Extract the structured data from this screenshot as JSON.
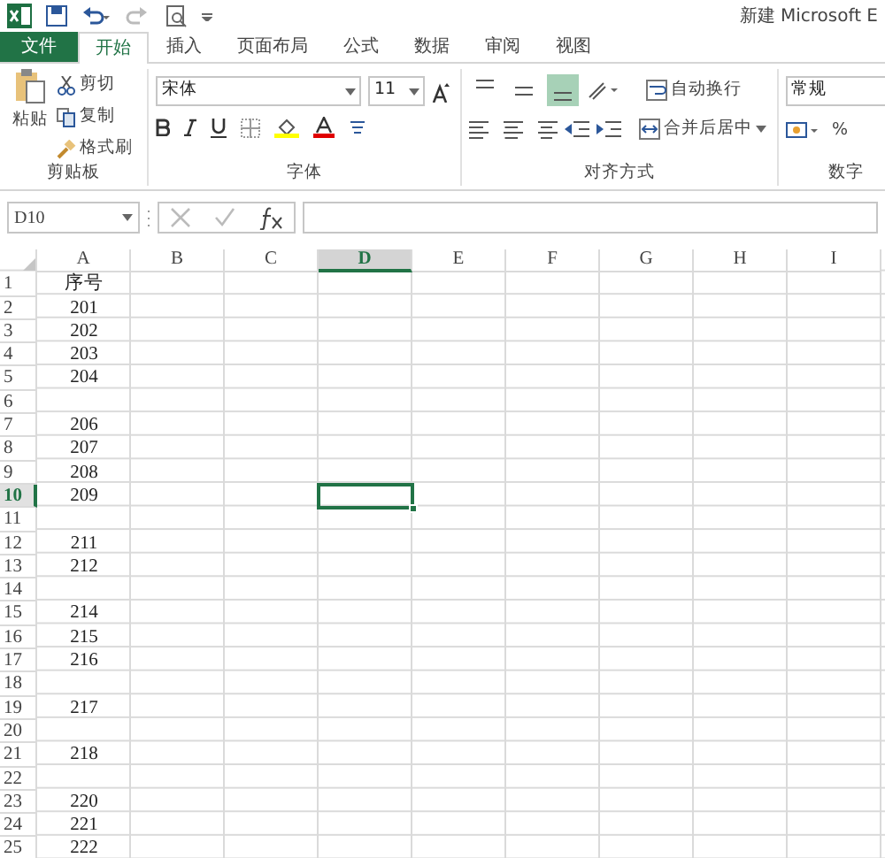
{
  "window": {
    "title": "新建 Microsoft E"
  },
  "tabs": [
    {
      "label": "文件",
      "kind": "file",
      "selected": false
    },
    {
      "label": "开始",
      "kind": "tab",
      "selected": true
    },
    {
      "label": "插入",
      "kind": "tab",
      "selected": false
    },
    {
      "label": "页面布局",
      "kind": "tab",
      "selected": false
    },
    {
      "label": "公式",
      "kind": "tab",
      "selected": false
    },
    {
      "label": "数据",
      "kind": "tab",
      "selected": false
    },
    {
      "label": "审阅",
      "kind": "tab",
      "selected": false
    },
    {
      "label": "视图",
      "kind": "tab",
      "selected": false
    }
  ],
  "clipboard": {
    "paste": "粘贴",
    "cut": "剪切",
    "copy": "复制",
    "format_painter": "格式刷",
    "label": "剪贴板"
  },
  "font": {
    "name": "宋体",
    "size": "11",
    "label": "字体"
  },
  "alignment": {
    "vertical": [
      {
        "selected": false
      },
      {
        "selected": false
      },
      {
        "selected": true
      }
    ],
    "wrap_text": "自动换行",
    "merge_center": "合并后居中",
    "label": "对齐方式"
  },
  "number": {
    "format": "常规",
    "percent": "%",
    "label": "数字"
  },
  "name_box": "D10",
  "columns": [
    {
      "label": "A",
      "selected": false
    },
    {
      "label": "B",
      "selected": false
    },
    {
      "label": "C",
      "selected": false
    },
    {
      "label": "D",
      "selected": true
    },
    {
      "label": "E",
      "selected": false
    },
    {
      "label": "F",
      "selected": false
    },
    {
      "label": "G",
      "selected": false
    },
    {
      "label": "H",
      "selected": false
    },
    {
      "label": "I",
      "selected": false
    }
  ],
  "rows": [
    {
      "number": "1",
      "value": "序号",
      "selected": false
    },
    {
      "number": "2",
      "value": "201",
      "selected": false
    },
    {
      "number": "3",
      "value": "202",
      "selected": false
    },
    {
      "number": "4",
      "value": "203",
      "selected": false
    },
    {
      "number": "5",
      "value": "204",
      "selected": false
    },
    {
      "number": "6",
      "selected": false
    },
    {
      "number": "7",
      "value": "206",
      "selected": false
    },
    {
      "number": "8",
      "value": "207",
      "selected": false
    },
    {
      "number": "9",
      "value": "208",
      "selected": false
    },
    {
      "number": "10",
      "value": "209",
      "selected": true
    },
    {
      "number": "11",
      "selected": false
    },
    {
      "number": "12",
      "value": "211",
      "selected": false
    },
    {
      "number": "13",
      "value": "212",
      "selected": false
    },
    {
      "number": "14",
      "selected": false
    },
    {
      "number": "15",
      "value": "214",
      "selected": false
    },
    {
      "number": "16",
      "value": "215",
      "selected": false
    },
    {
      "number": "17",
      "value": "216",
      "selected": false
    },
    {
      "number": "18",
      "selected": false
    },
    {
      "number": "19",
      "value": "217",
      "selected": false
    },
    {
      "number": "20",
      "selected": false
    },
    {
      "number": "21",
      "value": "218",
      "selected": false
    },
    {
      "number": "22",
      "selected": false
    },
    {
      "number": "23",
      "value": "220",
      "selected": false
    },
    {
      "number": "24",
      "value": "221",
      "selected": false
    },
    {
      "number": "25",
      "value": "222",
      "selected": false
    }
  ]
}
